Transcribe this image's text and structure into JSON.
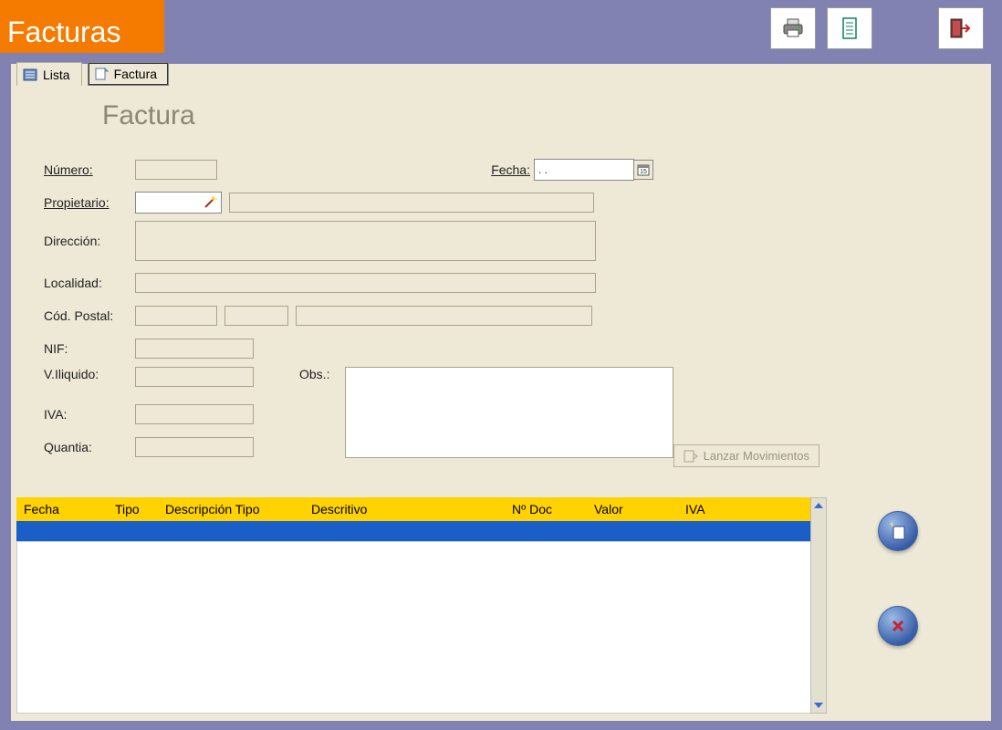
{
  "app_title": "Facturas",
  "tabs": {
    "lista": "Lista",
    "factura": "Factura"
  },
  "section_title": "Factura",
  "form": {
    "numero_label": "Número:",
    "fecha_label": "Fecha:",
    "fecha_value": ". .",
    "propietario_label": "Propietario:",
    "direccion_label": "Dirección:",
    "localidad_label": "Localidad:",
    "cod_postal_label": "Cód. Postal:",
    "nif_label": "NIF:",
    "vliquido_label": "V.Iliquido:",
    "iva_label": "IVA:",
    "quantia_label": "Quantia:",
    "obs_label": "Obs.:"
  },
  "lanzar_label": "Lanzar Movimientos",
  "grid_headers": {
    "fecha": "Fecha",
    "tipo": "Tipo",
    "desc_tipo": "Descripción Tipo",
    "descritivo": "Descritivo",
    "ndoc": "Nº Doc",
    "valor": "Valor",
    "iva": "IVA"
  }
}
